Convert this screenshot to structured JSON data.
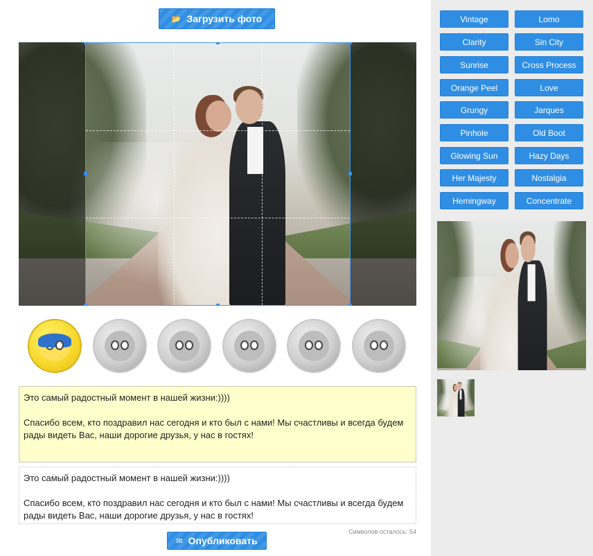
{
  "upload_button": {
    "label": "Загрузить фото",
    "icon": "folder-icon"
  },
  "photo": {
    "alt": "Свадебное фото"
  },
  "characters": [
    {
      "name": "joy",
      "selected": true
    },
    {
      "name": "sadness",
      "selected": false
    },
    {
      "name": "anger",
      "selected": false
    },
    {
      "name": "fear",
      "selected": false
    },
    {
      "name": "disgust",
      "selected": false
    },
    {
      "name": "bing-bong",
      "selected": false
    }
  ],
  "message": {
    "editor_text": "Это самый радостный момент в нашей жизни:))))\n\nСпасибо всем, кто поздравил нас сегодня и кто был с нами! Мы счастливы и всегда будем рады видеть Вас, наши дорогие друзья, у нас в гостях!",
    "preview_text": "Это самый радостный момент в нашей жизни:))))\n\nСпасибо всем, кто поздравил нас сегодня и кто был с нами! Мы счастливы и всегда будем рады видеть Вас, наши дорогие друзья, у нас в гостях!",
    "chars_left": "Символов осталось: 54"
  },
  "publish_button": {
    "label": "Опубликовать",
    "icon": "mail-icon"
  },
  "filters": [
    {
      "label": "Vintage"
    },
    {
      "label": "Lomo"
    },
    {
      "label": "Clarity"
    },
    {
      "label": "Sin City"
    },
    {
      "label": "Sunrise"
    },
    {
      "label": "Cross Process"
    },
    {
      "label": "Orange Peel"
    },
    {
      "label": "Love"
    },
    {
      "label": "Grungy"
    },
    {
      "label": "Jarques"
    },
    {
      "label": "Pinhole"
    },
    {
      "label": "Old Boot"
    },
    {
      "label": "Glowing Sun"
    },
    {
      "label": "Hazy Days"
    },
    {
      "label": "Her Majesty"
    },
    {
      "label": "Nostalgia"
    },
    {
      "label": "Hemingway"
    },
    {
      "label": "Concentrate"
    }
  ],
  "colors": {
    "button_blue": "#2f8ee3",
    "editor_bg": "#ffffcc",
    "sidebar_bg": "#ececec",
    "crop_border": "#4a98ee"
  }
}
